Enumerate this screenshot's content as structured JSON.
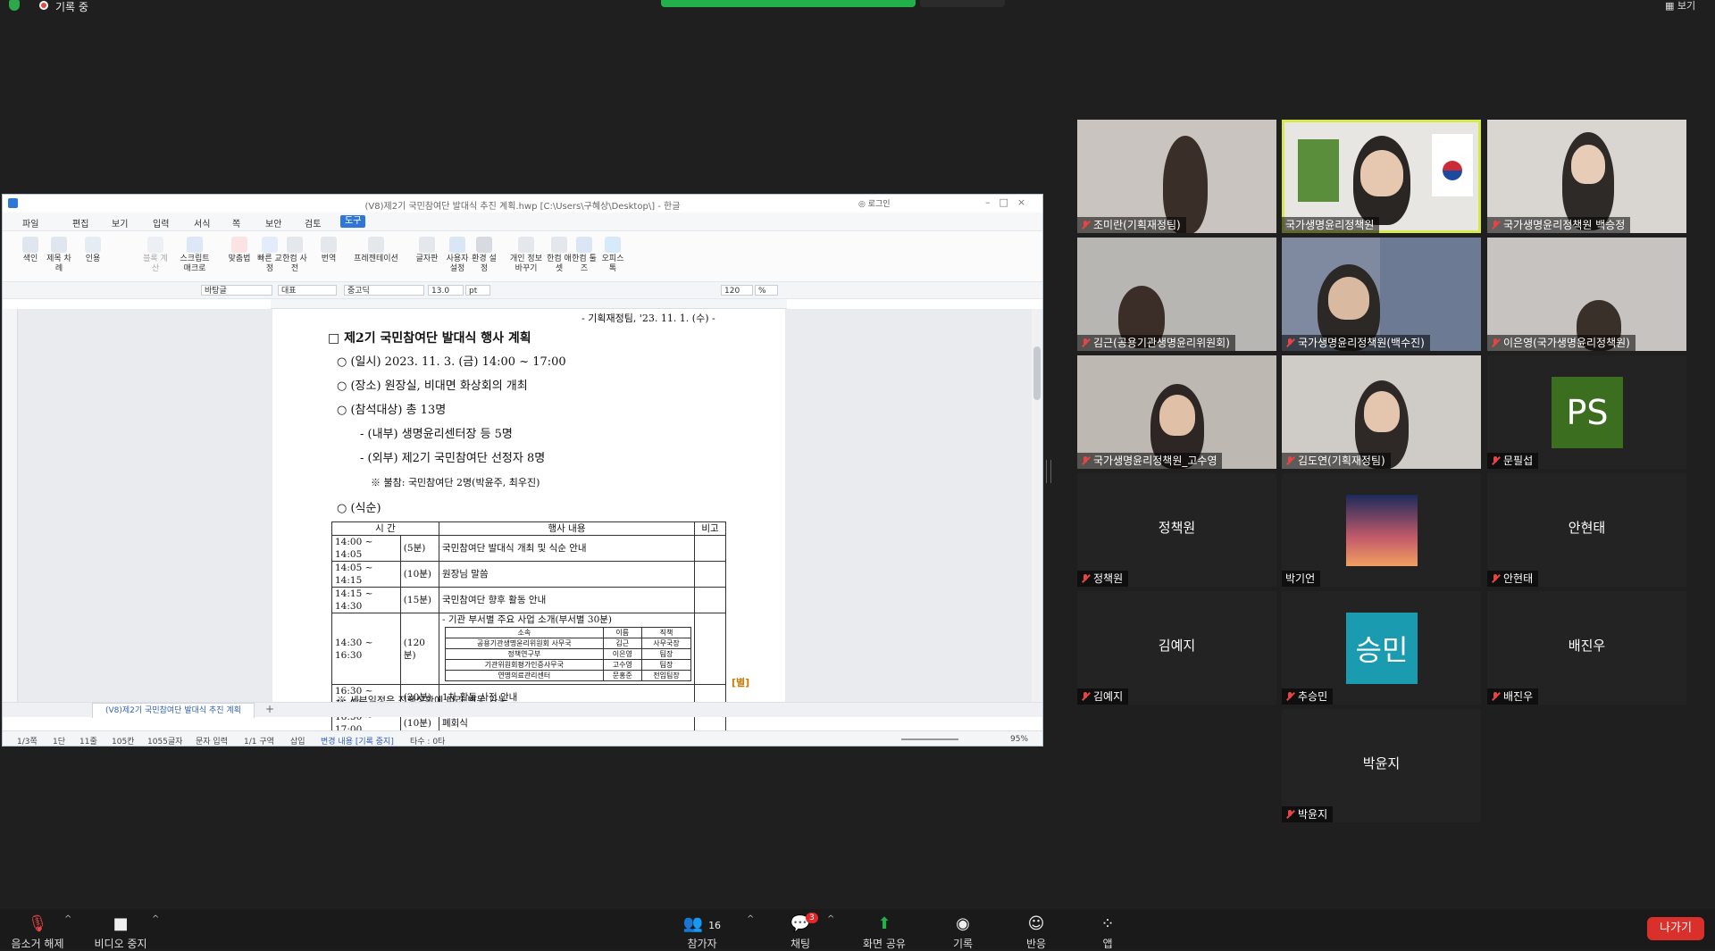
{
  "top": {
    "recording_label": "기록 중",
    "view_label": "보기"
  },
  "hwp": {
    "title": "(V8)제2기 국민참여단 발대식 추진 계획.hwp [C:\\Users\\구혜상\\Desktop\\] - 한글",
    "login": "로그인",
    "menus": [
      "파일",
      "편집",
      "보기",
      "입력",
      "서식",
      "쪽",
      "보안",
      "검토",
      "도구"
    ],
    "ribbon": [
      "색인",
      "제목 차례",
      "인용",
      "블록 계산",
      "스크립트 매크로",
      "맞춤법",
      "빠른 교정",
      "한컴 사전",
      "번역",
      "프레젠테이션",
      "글자판",
      "사용자 설정",
      "환경 설정",
      "개인 정보 바꾸기",
      "한컴 애셋",
      "한컴 툴즈",
      "오피스 톡"
    ],
    "format": {
      "style": "바탕글",
      "para": "대표",
      "font": "중고딕",
      "size": "13.0",
      "unit": "pt",
      "zoom_line": "120",
      "pct": "%"
    },
    "doc": {
      "top_line": "- 기획재정팀, '23. 11. 1. (수) -",
      "heading": "□ 제2기 국민참여단 발대식 행사 계획",
      "line1": "○ (일시) 2023. 11. 3. (금) 14:00 ~ 17:00",
      "line2": "○ (장소) 원장실, 비대면 화상회의 개최",
      "line3": "○ (참석대상) 총 13명",
      "line4": "- (내부) 생명윤리센터장 등 5명",
      "line5": "- (외부) 제2기 국민참여단 선정자 8명",
      "line6": "※ 불참: 국민참여단 2명(박윤주, 최우진)",
      "line7": "○ (식순)",
      "table_head": [
        "시 간",
        "행사 내용",
        "비고"
      ],
      "rows": [
        {
          "time": "14:00 ~ 14:05",
          "dur": "(5분)",
          "content": "국민참여단 발대식 개최 및 식순 안내"
        },
        {
          "time": "14:05 ~ 14:15",
          "dur": "(10분)",
          "content": "원장님 말씀"
        },
        {
          "time": "14:15 ~ 14:30",
          "dur": "(15분)",
          "content": "국민참여단 향후 활동 안내"
        },
        {
          "time": "14:30 ~ 16:30",
          "dur": "(120분)",
          "content": "- 기관 부서별 주요 사업 소개(부서별 30분)"
        },
        {
          "time": "16:30 ~ 16:50",
          "dur": "(20분)",
          "content": "1차 활동 사전 안내"
        },
        {
          "time": "16:50 ~ 17:00",
          "dur": "(10분)",
          "content": "폐회식"
        }
      ],
      "sub_head": [
        "소속",
        "이름",
        "직책"
      ],
      "sub_rows": [
        [
          "공용기관생명윤리위원회 사무국",
          "김근",
          "사무국장"
        ],
        [
          "정책연구부",
          "이은영",
          "팀장"
        ],
        [
          "기관위원회평가인증사무국",
          "고수영",
          "팀장"
        ],
        [
          "연명의료관리센터",
          "문홍준",
          "전임팀장"
        ]
      ],
      "mark": "[별]",
      "bottom_line": "※ 세부일정은 진행상황에 따라 변동 가능"
    },
    "tab_name": "(V8)제2기 국민참여단 발대식 추진 계획",
    "status": [
      "1/3쪽",
      "1단",
      "11줄",
      "105칸",
      "1055글자",
      "문자 입력",
      "1/1 구역",
      "삽입",
      "변경 내용 [기록 중지]",
      "타수 : 0타"
    ],
    "zoom": "95%"
  },
  "participants": [
    {
      "name": "조미란(기획재정팀)"
    },
    {
      "name": "국가생명윤리정책원"
    },
    {
      "name": "국가생명윤리정책원 백승정"
    },
    {
      "name": "김근(공용기관생명윤리위원회)"
    },
    {
      "name": "국가생명윤리정책원(백수진)"
    },
    {
      "name": "이은영(국가생명윤리정책원)"
    },
    {
      "name": "국가생명윤리정책원_고수영"
    },
    {
      "name": "김도연(기획재정팀)"
    },
    {
      "name": "문필섭",
      "initials": "PS"
    },
    {
      "name": "정책원",
      "display": "정책원"
    },
    {
      "name": "박기언"
    },
    {
      "name": "안현태",
      "display": "안현태"
    },
    {
      "name": "김예지",
      "display": "김예지"
    },
    {
      "name": "추승민",
      "initials": "승민"
    },
    {
      "name": "배진우",
      "display": "배진우"
    },
    {
      "name": "박윤지",
      "display": "박윤지"
    }
  ],
  "toolbar": {
    "unmute": "음소거 해제",
    "video": "비디오 중지",
    "participants": "참가자",
    "participants_count": "16",
    "chat": "채팅",
    "chat_badge": "3",
    "share": "화면 공유",
    "record": "기록",
    "reactions": "반응",
    "apps": "앱",
    "leave": "나가기"
  },
  "colors": {
    "share_green": "#22b04b",
    "leave_red": "#d9302b",
    "active_speaker": "#d6e94a",
    "ps_avatar": "#3b6f1f",
    "sm_avatar": "#1a9bb0"
  }
}
